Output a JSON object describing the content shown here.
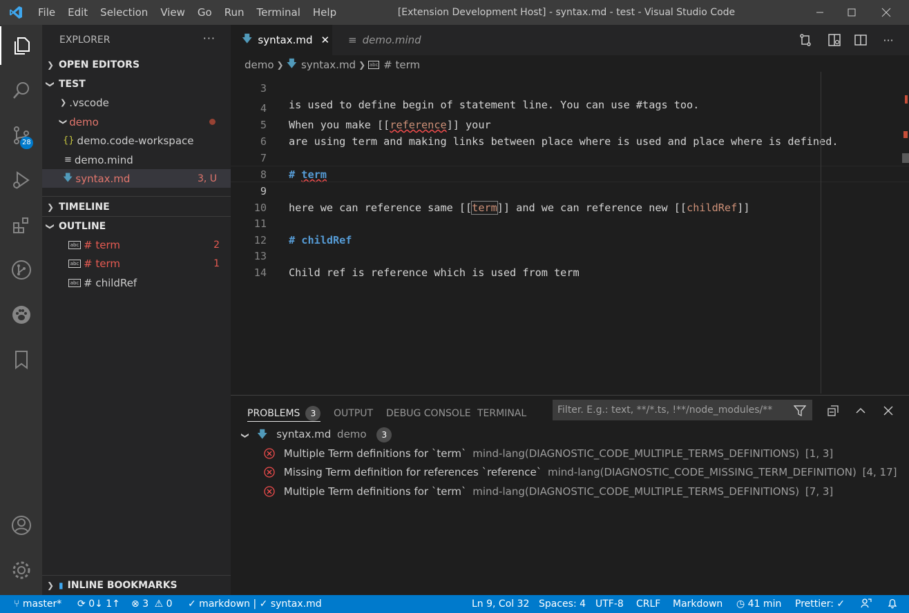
{
  "titlebar": {
    "menus": [
      "File",
      "Edit",
      "Selection",
      "View",
      "Go",
      "Run",
      "Terminal",
      "Help"
    ],
    "title": "[Extension Development Host] - syntax.md - test - Visual Studio Code"
  },
  "activity": {
    "source_control_badge": "28",
    "icons": [
      "explorer-icon",
      "search-icon",
      "source-control-icon",
      "run-debug-icon",
      "extensions-icon",
      "git-graph-icon",
      "paw-icon",
      "bookmark-icon",
      "account-icon",
      "settings-gear-icon"
    ]
  },
  "sidebar": {
    "title": "EXPLORER",
    "more": "···",
    "open_editors": "OPEN EDITORS",
    "folder": "TEST",
    "items": [
      {
        "label": ".vscode"
      },
      {
        "label": "demo"
      },
      {
        "label": "demo.code-workspace"
      },
      {
        "label": "demo.mind"
      },
      {
        "label": "syntax.md",
        "decoration": "3, U"
      }
    ],
    "timeline": "TIMELINE",
    "outline": "OUTLINE",
    "outline_items": [
      {
        "label": "# term",
        "count": "2"
      },
      {
        "label": "# term",
        "count": "1"
      },
      {
        "label": "# childRef",
        "count": ""
      }
    ],
    "bookmarks": "INLINE BOOKMARKS"
  },
  "tabs": [
    {
      "label": "syntax.md",
      "close": "✕"
    },
    {
      "label": "demo.mind"
    }
  ],
  "breadcrumb": {
    "folder": "demo",
    "file": "syntax.md",
    "symbol": "# term"
  },
  "editor": {
    "lines": [
      {
        "num": "3",
        "text": "is used to define begin of statement line. You can use #tags too."
      },
      {
        "num": "4",
        "pre": "When you make [[",
        "ref": "reference",
        "post": "]] your"
      },
      {
        "num": "5",
        "text": "are using term and making links between place where is used and place where is defined."
      },
      {
        "num": "6",
        "text": ""
      },
      {
        "num": "7",
        "hash": "# ",
        "heading": "term"
      },
      {
        "num": "8",
        "text": ""
      },
      {
        "num": "9",
        "pre": "here we can reference same [[",
        "ref": "term",
        "mid": "]] and we can reference new [[",
        "ref2": "childRef",
        "post": "]]"
      },
      {
        "num": "10",
        "text": ""
      },
      {
        "num": "11",
        "hash": "# ",
        "heading": "childRef"
      },
      {
        "num": "12",
        "text": ""
      },
      {
        "num": "13",
        "text": "Child ref is reference which is used from term"
      },
      {
        "num": "14",
        "text": ""
      }
    ]
  },
  "panel": {
    "tabs": [
      "PROBLEMS",
      "OUTPUT",
      "DEBUG CONSOLE",
      "TERMINAL"
    ],
    "problems_count": "3",
    "filter_placeholder": "Filter. E.g.: text, **/*.ts, !**/node_modules/**",
    "file": {
      "name": "syntax.md",
      "folder": "demo",
      "count": "3"
    },
    "problems": [
      {
        "message": "Multiple Term definitions for `term`",
        "source": "mind-lang(DIAGNOSTIC_CODE_MULTIPLE_TERMS_DEFINITIONS)",
        "pos": "[1, 3]"
      },
      {
        "message": "Missing Term definition for references `reference`",
        "source": "mind-lang(DIAGNOSTIC_CODE_MISSING_TERM_DEFINITION)",
        "pos": "[4, 17]"
      },
      {
        "message": "Multiple Term definitions for `term`",
        "source": "mind-lang(DIAGNOSTIC_CODE_MULTIPLE_TERMS_DEFINITIONS)",
        "pos": "[7, 3]"
      }
    ]
  },
  "statusbar": {
    "branch": "master*",
    "sync": "0↓ 1↑",
    "errors": "3",
    "warnings": "0",
    "lint": "✓ markdown | ✓ syntax.md",
    "position": "Ln 9, Col 32",
    "spaces": "Spaces: 4",
    "encoding": "UTF-8",
    "eol": "CRLF",
    "language": "Markdown",
    "time": "41 min",
    "prettier": "Prettier: ✓"
  },
  "colors": {
    "accent": "#007acc",
    "error": "#f14c4c",
    "heading": "#569cd6",
    "reference": "#ce9178"
  }
}
